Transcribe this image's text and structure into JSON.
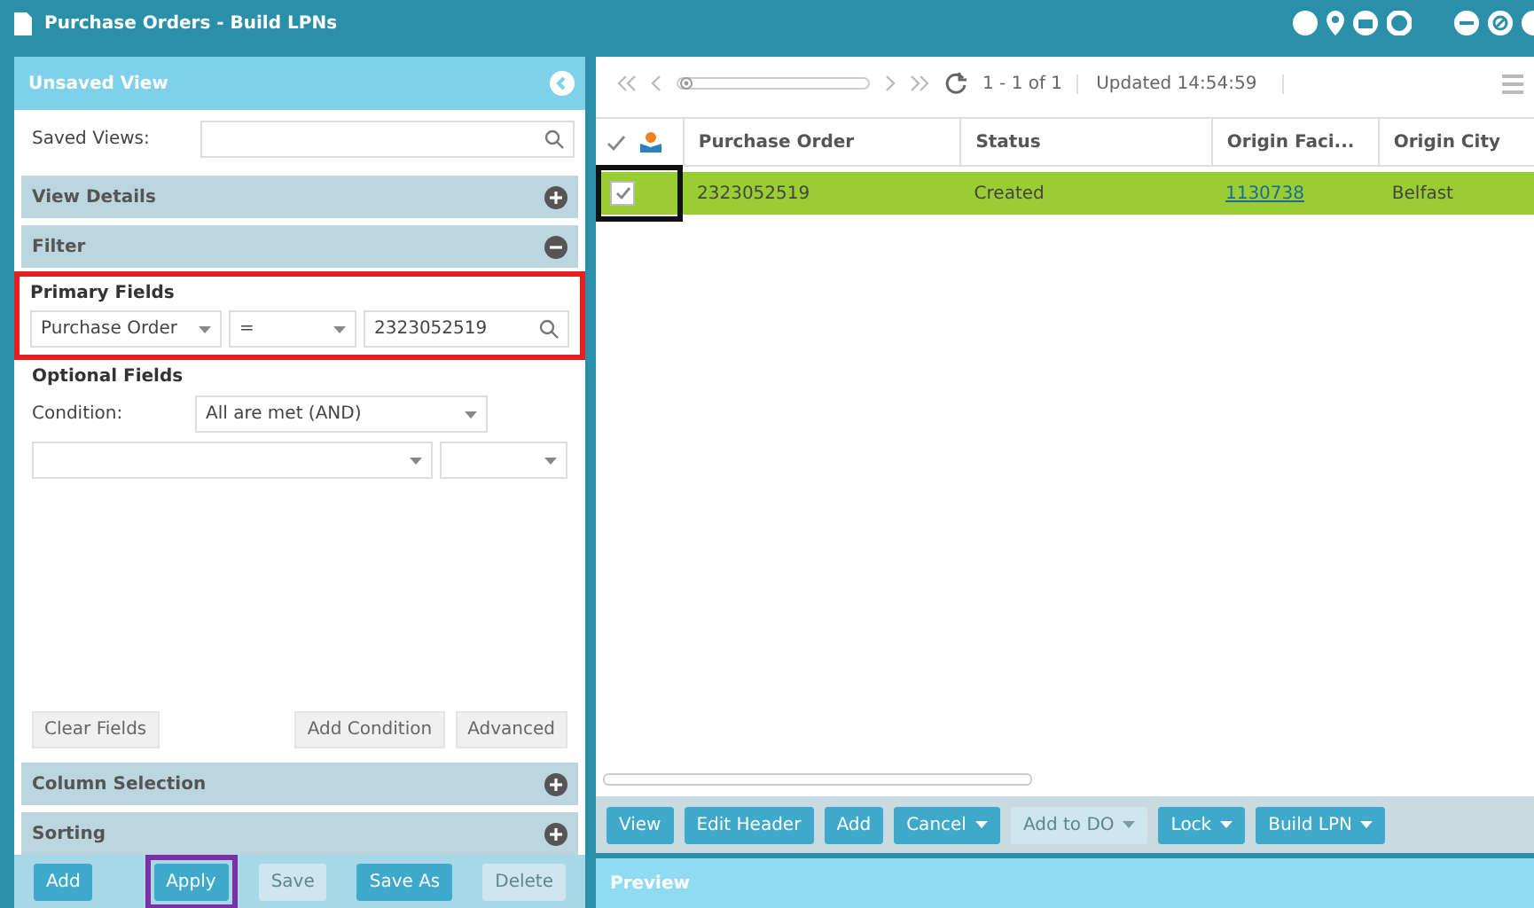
{
  "window": {
    "title": "Purchase Orders - Build LPNs"
  },
  "left_panel": {
    "title": "Unsaved View",
    "saved_views": {
      "label": "Saved Views:"
    },
    "sections_top": [
      {
        "label": "View Details",
        "expanded": false
      },
      {
        "label": "Filter",
        "expanded": true
      }
    ],
    "primary_fields": {
      "title": "Primary Fields",
      "highlighted": true,
      "field": "Purchase Order",
      "operator": "=",
      "value": "2323052519"
    },
    "optional_fields": {
      "title": "Optional Fields",
      "condition_label": "Condition:",
      "condition": "All are met (AND)"
    },
    "filter_buttons": [
      "Clear Fields",
      "Add Condition",
      "Advanced"
    ],
    "sections_bottom": [
      {
        "label": "Column Selection",
        "expanded": false
      },
      {
        "label": "Sorting",
        "expanded": false
      }
    ],
    "footer_buttons": [
      {
        "label": "Add",
        "disabled": false,
        "highlighted": false
      },
      {
        "label": "Apply",
        "disabled": false,
        "highlighted": true
      },
      {
        "label": "Save",
        "disabled": true,
        "highlighted": false
      },
      {
        "label": "Save As",
        "disabled": false,
        "highlighted": false
      },
      {
        "label": "Delete",
        "disabled": true,
        "highlighted": false
      }
    ]
  },
  "toolbar": {
    "pager": {
      "level": 0
    },
    "range": "1 - 1 of 1",
    "updated": "Updated 14:54:59"
  },
  "table": {
    "columns": [
      "Purchase Order",
      "Status",
      "Origin Faci...",
      "Origin City"
    ],
    "rows": [
      {
        "selected": true,
        "checked": true,
        "highlighted": true,
        "cells": [
          "2323052519",
          "Created",
          "1130738",
          "Belfast"
        ]
      }
    ]
  },
  "actions": [
    {
      "label": "View",
      "disabled": false,
      "dropdown": false
    },
    {
      "label": "Edit Header",
      "disabled": false,
      "dropdown": false
    },
    {
      "label": "Add",
      "disabled": false,
      "dropdown": false
    },
    {
      "label": "Cancel",
      "disabled": false,
      "dropdown": true
    },
    {
      "label": "Add to DO",
      "disabled": true,
      "dropdown": true
    },
    {
      "label": "Lock",
      "disabled": false,
      "dropdown": true
    },
    {
      "label": "Build LPN",
      "disabled": false,
      "dropdown": true
    }
  ],
  "preview": {
    "title": "Preview"
  }
}
